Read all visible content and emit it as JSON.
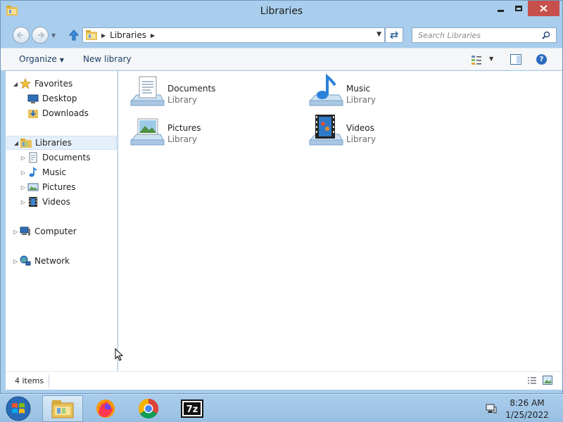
{
  "window": {
    "title": "Libraries",
    "icons": {
      "app": "libraries-folder-icon",
      "minimize": "minimize-icon",
      "maximize": "maximize-icon",
      "close": "close-icon"
    }
  },
  "address_bar": {
    "crumbs": [
      "Libraries"
    ],
    "search_placeholder": "Search Libraries"
  },
  "command_bar": {
    "organize_label": "Organize",
    "new_library_label": "New library"
  },
  "nav_pane": {
    "favorites": {
      "label": "Favorites",
      "items": [
        {
          "label": "Desktop"
        },
        {
          "label": "Downloads"
        }
      ]
    },
    "libraries": {
      "label": "Libraries",
      "items": [
        {
          "label": "Documents"
        },
        {
          "label": "Music"
        },
        {
          "label": "Pictures"
        },
        {
          "label": "Videos"
        }
      ]
    },
    "computer": {
      "label": "Computer"
    },
    "network": {
      "label": "Network"
    }
  },
  "libraries": [
    {
      "name": "Documents",
      "type": "Library",
      "icon": "documents-library-icon"
    },
    {
      "name": "Music",
      "type": "Library",
      "icon": "music-library-icon"
    },
    {
      "name": "Pictures",
      "type": "Library",
      "icon": "pictures-library-icon"
    },
    {
      "name": "Videos",
      "type": "Library",
      "icon": "videos-library-icon"
    }
  ],
  "status_bar": {
    "item_count": "4 items"
  },
  "taskbar": {
    "pinned": [
      "file-explorer",
      "firefox",
      "chrome",
      "7-zip"
    ],
    "clock_time": "8:26 AM",
    "clock_date": "1/25/2022"
  },
  "colors": {
    "title_bar": "#a9cdec",
    "close_button": "#c7504c",
    "selection": "#e5f0fa",
    "link_text": "#1e3f66"
  }
}
